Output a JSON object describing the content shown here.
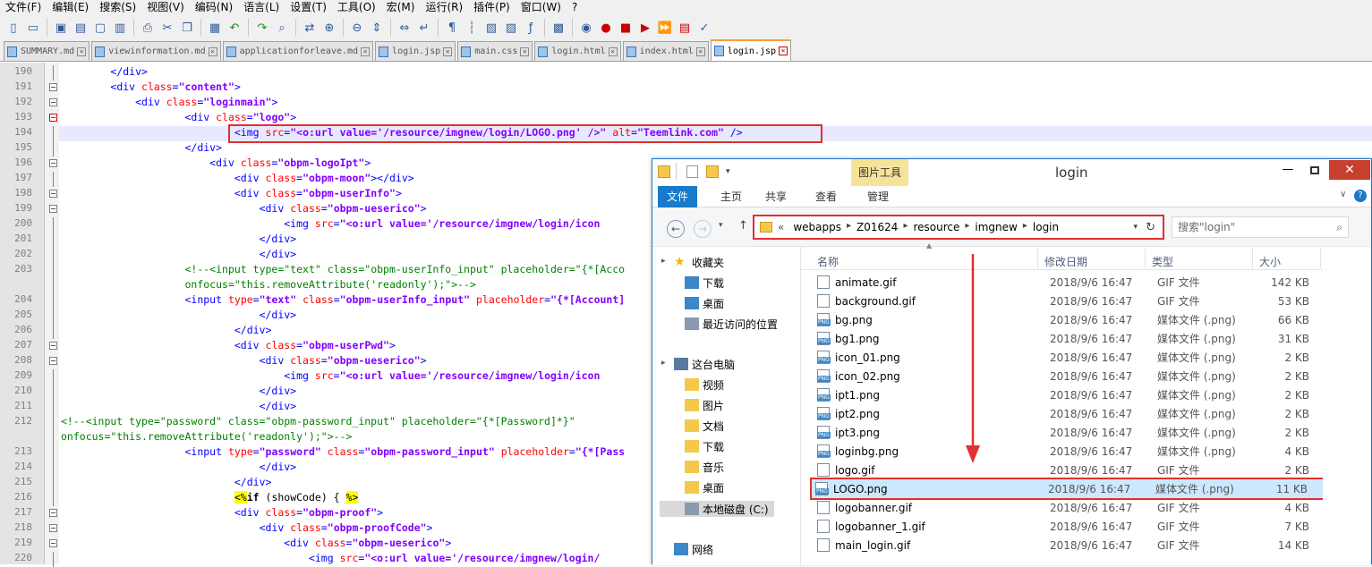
{
  "menubar": [
    "文件(F)",
    "编辑(E)",
    "搜索(S)",
    "视图(V)",
    "编码(N)",
    "语言(L)",
    "设置(T)",
    "工具(O)",
    "宏(M)",
    "运行(R)",
    "插件(P)",
    "窗口(W)",
    "?"
  ],
  "tabs": [
    {
      "label": "SUMMARY.md",
      "active": false
    },
    {
      "label": "viewinformation.md",
      "active": false
    },
    {
      "label": "applicationforleave.md",
      "active": false
    },
    {
      "label": "login.jsp",
      "active": false
    },
    {
      "label": "main.css",
      "active": false
    },
    {
      "label": "login.html",
      "active": false
    },
    {
      "label": "index.html",
      "active": false
    },
    {
      "label": "login.jsp",
      "active": true
    }
  ],
  "editor": {
    "lines": [
      {
        "n": "190",
        "html": "        <span class='t'>&lt;/div&gt;</span>"
      },
      {
        "n": "191",
        "html": "        <span class='t'>&lt;div</span> <span class='a'>class</span><span class='t'>=</span><span class='v'>\"content\"</span><span class='t'>&gt;</span>"
      },
      {
        "n": "192",
        "html": "            <span class='t'>&lt;div</span> <span class='a'>class</span><span class='t'>=</span><span class='v'>\"loginmain\"</span><span class='t'>&gt;</span>"
      },
      {
        "n": "193",
        "html": "                    <span class='t'>&lt;div</span> <span class='a'>class</span><span class='t'>=</span><span class='v'>\"logo\"</span><span class='t'>&gt;</span>"
      },
      {
        "n": "194",
        "html": "                            <span class='t'>&lt;img</span> <span class='a'>src</span><span class='t'>=</span><span class='v'>\"&lt;o:url value='/resource/imgnew/login/LOGO.png' /&gt;\"</span> <span class='a'>alt</span><span class='t'>=</span><span class='v'>\"Teemlink.com\"</span> <span class='t'>/&gt;</span>"
      },
      {
        "n": "195",
        "html": "                    <span class='t'>&lt;/div&gt;</span>"
      },
      {
        "n": "196",
        "html": "                        <span class='t'>&lt;div</span> <span class='a'>class</span><span class='t'>=</span><span class='v'>\"obpm-logoIpt\"</span><span class='t'>&gt;</span>"
      },
      {
        "n": "197",
        "html": "                            <span class='t'>&lt;div</span> <span class='a'>class</span><span class='t'>=</span><span class='v'>\"obpm-moon\"</span><span class='t'>&gt;&lt;/div&gt;</span>"
      },
      {
        "n": "198",
        "html": "                            <span class='t'>&lt;div</span> <span class='a'>class</span><span class='t'>=</span><span class='v'>\"obpm-userInfo\"</span><span class='t'>&gt;</span>"
      },
      {
        "n": "199",
        "html": "                                <span class='t'>&lt;div</span> <span class='a'>class</span><span class='t'>=</span><span class='v'>\"obpm-ueserico\"</span><span class='t'>&gt;</span>"
      },
      {
        "n": "200",
        "html": "                                    <span class='t'>&lt;img</span> <span class='a'>src</span><span class='t'>=</span><span class='v'>\"&lt;o:url value='/resource/imgnew/login/icon</span>"
      },
      {
        "n": "201",
        "html": "                                <span class='t'>&lt;/div&gt;</span>"
      },
      {
        "n": "202",
        "html": "                                <span class='t'>&lt;/div&gt;</span>"
      },
      {
        "n": "203",
        "html": "                    <span class='c'>&lt;!--&lt;input type=\"text\" class=\"obpm-userInfo_input\" placeholder=\"{*[Acco</span>"
      },
      {
        "n": "",
        "html": "                    <span class='c'>onfocus=\"this.removeAttribute('readonly');\"&gt;--&gt;</span>"
      },
      {
        "n": "204",
        "html": "                    <span class='t'>&lt;input</span> <span class='a'>type</span><span class='t'>=</span><span class='v'>\"text\"</span> <span class='a'>class</span><span class='t'>=</span><span class='v'>\"obpm-userInfo_input\"</span> <span class='a'>placeholder</span><span class='t'>=</span><span class='v'>\"{*[Account]</span>"
      },
      {
        "n": "205",
        "html": "                                <span class='t'>&lt;/div&gt;</span>"
      },
      {
        "n": "206",
        "html": "                            <span class='t'>&lt;/div&gt;</span>"
      },
      {
        "n": "207",
        "html": "                            <span class='t'>&lt;div</span> <span class='a'>class</span><span class='t'>=</span><span class='v'>\"obpm-userPwd\"</span><span class='t'>&gt;</span>"
      },
      {
        "n": "208",
        "html": "                                <span class='t'>&lt;div</span> <span class='a'>class</span><span class='t'>=</span><span class='v'>\"obpm-ueserico\"</span><span class='t'>&gt;</span>"
      },
      {
        "n": "209",
        "html": "                                    <span class='t'>&lt;img</span> <span class='a'>src</span><span class='t'>=</span><span class='v'>\"&lt;o:url value='/resource/imgnew/login/icon</span>"
      },
      {
        "n": "210",
        "html": "                                <span class='t'>&lt;/div&gt;</span>"
      },
      {
        "n": "211",
        "html": "                                <span class='t'>&lt;/div&gt;</span>"
      },
      {
        "n": "212",
        "html": "<span class='c'>&lt;!--&lt;input type=\"password\" class=\"obpm-password_input\" placeholder=\"{*[Password]*}\"</span>"
      },
      {
        "n": "",
        "html": "<span class='c'>onfocus=\"this.removeAttribute('readonly');\"&gt;--&gt;</span>"
      },
      {
        "n": "213",
        "html": "                    <span class='t'>&lt;input</span> <span class='a'>type</span><span class='t'>=</span><span class='v'>\"password\"</span> <span class='a'>class</span><span class='t'>=</span><span class='v'>\"obpm-password_input\"</span> <span class='a'>placeholder</span><span class='t'>=</span><span class='v'>\"{*[Pass</span>"
      },
      {
        "n": "214",
        "html": "                                <span class='t'>&lt;/div&gt;</span>"
      },
      {
        "n": "215",
        "html": "                            <span class='t'>&lt;/div&gt;</span>"
      },
      {
        "n": "216",
        "html": "                            <span style='background:#ffff00'>&lt;%</span><b>if</b> (showCode) { <span style='background:#ffff00'>%&gt;</span>"
      },
      {
        "n": "217",
        "html": "                            <span class='t'>&lt;div</span> <span class='a'>class</span><span class='t'>=</span><span class='v'>\"obpm-proof\"</span><span class='t'>&gt;</span>"
      },
      {
        "n": "218",
        "html": "                                <span class='t'>&lt;div</span> <span class='a'>class</span><span class='t'>=</span><span class='v'>\"obpm-proofCode\"</span><span class='t'>&gt;</span>"
      },
      {
        "n": "219",
        "html": "                                    <span class='t'>&lt;div</span> <span class='a'>class</span><span class='t'>=</span><span class='v'>\"obpm-ueserico\"</span><span class='t'>&gt;</span>"
      },
      {
        "n": "220",
        "html": "                                        <span class='t'>&lt;img</span> <span class='a'>src</span><span class='t'>=</span><span class='v'>\"&lt;o:url value='/resource/imgnew/login/</span>"
      }
    ]
  },
  "explorer": {
    "title": "login",
    "picture_tools": "图片工具",
    "ribbon_tabs": [
      "文件",
      "主页",
      "共享",
      "查看",
      "管理"
    ],
    "breadcrumb": [
      "webapps",
      "Z01624",
      "resource",
      "imgnew",
      "login"
    ],
    "breadcrumb_prefix": "«",
    "search_placeholder": "搜索\"login\"",
    "columns": {
      "name": "名称",
      "date": "修改日期",
      "type": "类型",
      "size": "大小"
    },
    "nav": [
      {
        "label": "收藏夹",
        "icon": "star-icon"
      },
      {
        "label": "下载",
        "icon": "download-folder-icon"
      },
      {
        "label": "桌面",
        "icon": "desktop-icon"
      },
      {
        "label": "最近访问的位置",
        "icon": "recent-icon"
      },
      {
        "label": "这台电脑",
        "icon": "computer-icon"
      },
      {
        "label": "视频",
        "icon": "folder-icon"
      },
      {
        "label": "图片",
        "icon": "folder-icon"
      },
      {
        "label": "文档",
        "icon": "folder-icon"
      },
      {
        "label": "下载",
        "icon": "folder-icon"
      },
      {
        "label": "音乐",
        "icon": "folder-icon"
      },
      {
        "label": "桌面",
        "icon": "folder-icon"
      },
      {
        "label": "本地磁盘 (C:)",
        "icon": "drive-icon"
      },
      {
        "label": "网络",
        "icon": "network-icon"
      }
    ],
    "files": [
      {
        "name": "animate.gif",
        "date": "2018/9/6 16:47",
        "type": "GIF 文件",
        "size": "142 KB",
        "kind": "gif"
      },
      {
        "name": "background.gif",
        "date": "2018/9/6 16:47",
        "type": "GIF 文件",
        "size": "53 KB",
        "kind": "gif"
      },
      {
        "name": "bg.png",
        "date": "2018/9/6 16:47",
        "type": "媒体文件 (.png)",
        "size": "66 KB",
        "kind": "png"
      },
      {
        "name": "bg1.png",
        "date": "2018/9/6 16:47",
        "type": "媒体文件 (.png)",
        "size": "31 KB",
        "kind": "png"
      },
      {
        "name": "icon_01.png",
        "date": "2018/9/6 16:47",
        "type": "媒体文件 (.png)",
        "size": "2 KB",
        "kind": "png"
      },
      {
        "name": "icon_02.png",
        "date": "2018/9/6 16:47",
        "type": "媒体文件 (.png)",
        "size": "2 KB",
        "kind": "png"
      },
      {
        "name": "ipt1.png",
        "date": "2018/9/6 16:47",
        "type": "媒体文件 (.png)",
        "size": "2 KB",
        "kind": "png"
      },
      {
        "name": "ipt2.png",
        "date": "2018/9/6 16:47",
        "type": "媒体文件 (.png)",
        "size": "2 KB",
        "kind": "png"
      },
      {
        "name": "ipt3.png",
        "date": "2018/9/6 16:47",
        "type": "媒体文件 (.png)",
        "size": "2 KB",
        "kind": "png"
      },
      {
        "name": "loginbg.png",
        "date": "2018/9/6 16:47",
        "type": "媒体文件 (.png)",
        "size": "4 KB",
        "kind": "png"
      },
      {
        "name": "logo.gif",
        "date": "2018/9/6 16:47",
        "type": "GIF 文件",
        "size": "2 KB",
        "kind": "gif"
      },
      {
        "name": "LOGO.png",
        "date": "2018/9/6 16:47",
        "type": "媒体文件 (.png)",
        "size": "11 KB",
        "kind": "png",
        "selected": true
      },
      {
        "name": "logobanner.gif",
        "date": "2018/9/6 16:47",
        "type": "GIF 文件",
        "size": "4 KB",
        "kind": "gif"
      },
      {
        "name": "logobanner_1.gif",
        "date": "2018/9/6 16:47",
        "type": "GIF 文件",
        "size": "7 KB",
        "kind": "gif"
      },
      {
        "name": "main_login.gif",
        "date": "2018/9/6 16:47",
        "type": "GIF 文件",
        "size": "14 KB",
        "kind": "gif"
      }
    ]
  },
  "toolbar_icons": [
    "new-file-icon",
    "open-icon",
    "save-icon",
    "save-all-icon",
    "close-icon",
    "close-all-icon",
    "print-icon",
    "cut-icon",
    "copy-icon",
    "paste-icon",
    "undo-icon",
    "redo-icon",
    "find-icon",
    "replace-icon",
    "zoom-in-icon",
    "zoom-out-icon",
    "sync-v-icon",
    "sync-h-icon",
    "word-wrap-icon",
    "show-all-chars-icon",
    "indent-guide-icon",
    "udl-icon",
    "doc-map-icon",
    "function-list-icon",
    "folder-workspace-icon",
    "monitor-icon",
    "record-macro-icon",
    "stop-macro-icon",
    "play-macro-icon",
    "play-multi-icon",
    "save-macro-icon",
    "spellcheck-icon"
  ],
  "colors": {
    "highlight": "#e03030",
    "selection": "#cce8ff",
    "accent": "#1979ca"
  }
}
